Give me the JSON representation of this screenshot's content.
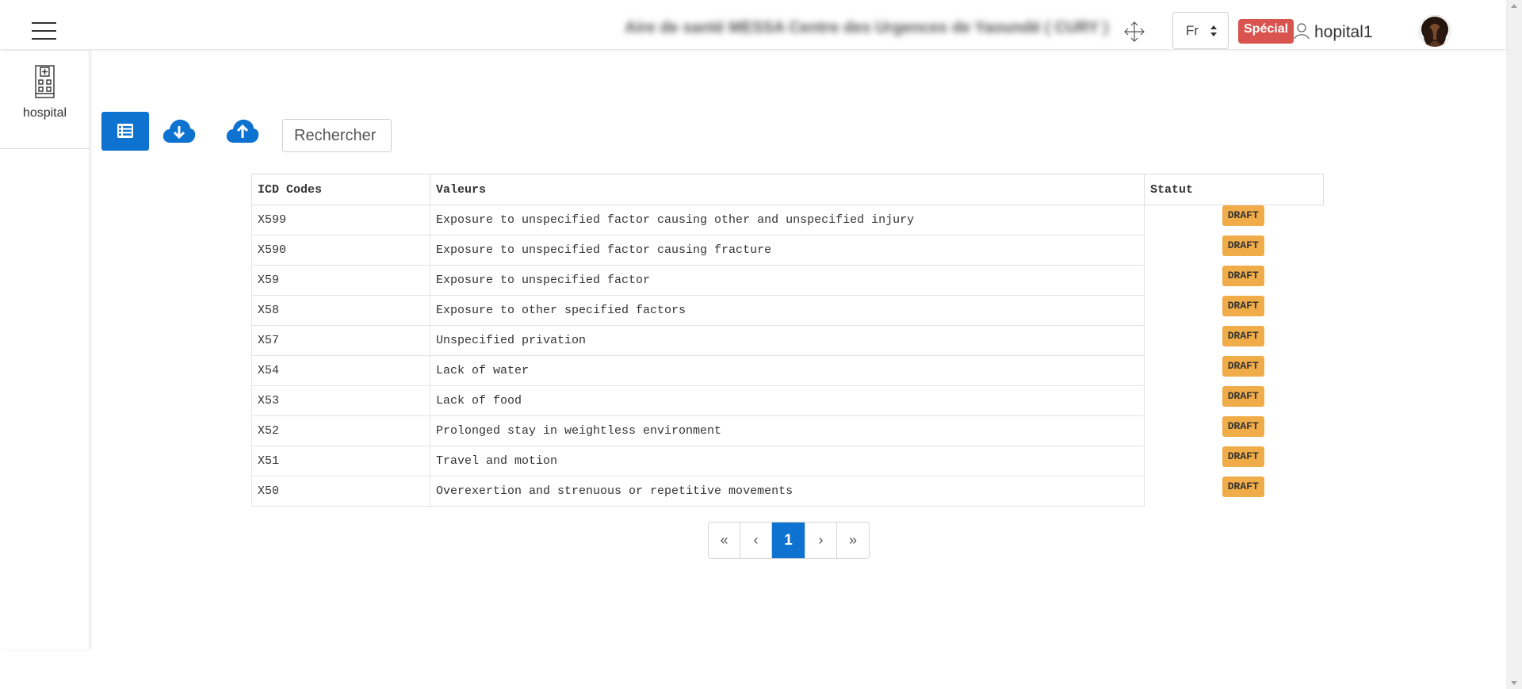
{
  "header": {
    "facility_name": "Aire de santé MESSA Centre des Urgences de Yaoundé ( CURY )",
    "language": "Fr",
    "special_badge": "Spécial",
    "username": "hopital1"
  },
  "sidebar": {
    "items": [
      {
        "label": "hospital",
        "icon": "hospital-icon"
      }
    ]
  },
  "toolbar": {
    "list_icon": "list-icon",
    "download_icon": "cloud-download-icon",
    "upload_icon": "cloud-upload-icon",
    "search_placeholder": "Rechercher"
  },
  "table": {
    "headers": {
      "code": "ICD Codes",
      "value": "Valeurs",
      "status": "Statut"
    },
    "rows": [
      {
        "code": "X599",
        "value": "Exposure to unspecified factor causing other and unspecified injury",
        "status": "DRAFT"
      },
      {
        "code": "X590",
        "value": "Exposure to unspecified factor causing fracture",
        "status": "DRAFT"
      },
      {
        "code": "X59",
        "value": "Exposure to unspecified factor",
        "status": "DRAFT"
      },
      {
        "code": "X58",
        "value": "Exposure to other specified factors",
        "status": "DRAFT"
      },
      {
        "code": "X57",
        "value": "Unspecified privation",
        "status": "DRAFT"
      },
      {
        "code": "X54",
        "value": "Lack of water",
        "status": "DRAFT"
      },
      {
        "code": "X53",
        "value": "Lack of food",
        "status": "DRAFT"
      },
      {
        "code": "X52",
        "value": "Prolonged stay in weightless environment",
        "status": "DRAFT"
      },
      {
        "code": "X51",
        "value": "Travel and motion",
        "status": "DRAFT"
      },
      {
        "code": "X50",
        "value": "Overexertion and strenuous or repetitive movements",
        "status": "DRAFT"
      }
    ]
  },
  "pagination": {
    "first": "«",
    "prev": "‹",
    "current": "1",
    "next": "›",
    "last": "»"
  },
  "colors": {
    "primary": "#0d72d0",
    "special": "#d9534f",
    "draft": "#efac48"
  }
}
